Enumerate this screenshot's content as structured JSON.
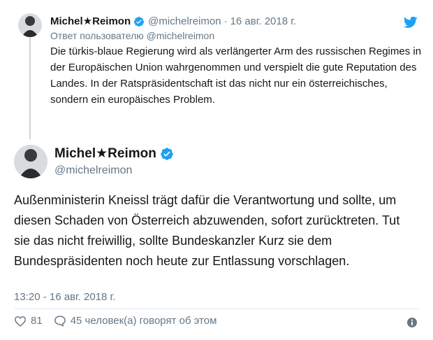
{
  "parent_tweet": {
    "name": "Michel★Reimon",
    "handle": "@michelreimon",
    "separator": "·",
    "date": "16 авг. 2018 г.",
    "reply_to": "Ответ пользователю @michelreimon",
    "text": "Die türkis-blaue Regierung wird als verlängerter Arm des russischen Regimes in der Europäischen Union wahrgenommen und verspielt die gute Reputation des Landes. In der Ratspräsidentschaft ist das nicht nur ein österreichisches, sondern ein europäisches Problem."
  },
  "main_tweet": {
    "name": "Michel★Reimon",
    "handle": "@michelreimon",
    "text": "Außenministerin Kneissl trägt dafür die Verantwortung und sollte, um diesen Schaden von Österreich abzuwenden, sofort zurücktreten. Tut sie das nicht freiwillig, sollte Bundeskanzler Kurz sie dem Bundespräsidenten noch heute zur Entlassung vorschlagen.",
    "timestamp": "13:20 - 16 авг. 2018 г."
  },
  "actions": {
    "likes": "81",
    "replies": "45 человек(а) говорят об этом"
  },
  "icons": {
    "verified": "verified-badge-icon",
    "twitter": "twitter-bird-icon",
    "like": "heart-icon",
    "reply": "comment-bubble-icon",
    "info": "info-icon"
  },
  "colors": {
    "accent": "#1da1f2",
    "muted": "#657786",
    "text": "#14171a"
  }
}
